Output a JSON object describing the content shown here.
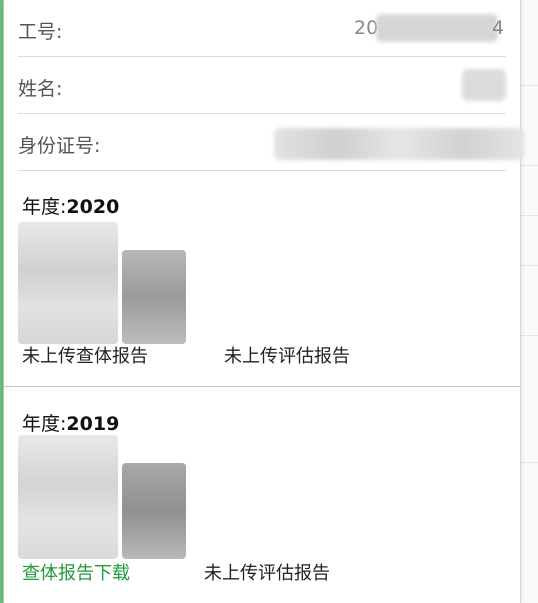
{
  "employee": {
    "id_label": "工号:",
    "id_value_visible_start": "20",
    "id_value_visible_end": "4",
    "name_label": "姓名:",
    "idcard_label": "身份证号:"
  },
  "records": [
    {
      "year_label": "年度:",
      "year": "2020",
      "report_left": "未上传查体报告",
      "report_right": "未上传评估报告"
    },
    {
      "year_label": "年度:",
      "year": "2019",
      "report_left": "查体报告下载",
      "report_right": "未上传评估报告"
    }
  ],
  "colors": {
    "link_green": "#1f9b3a",
    "accent_blue": "#3a8ee6"
  }
}
